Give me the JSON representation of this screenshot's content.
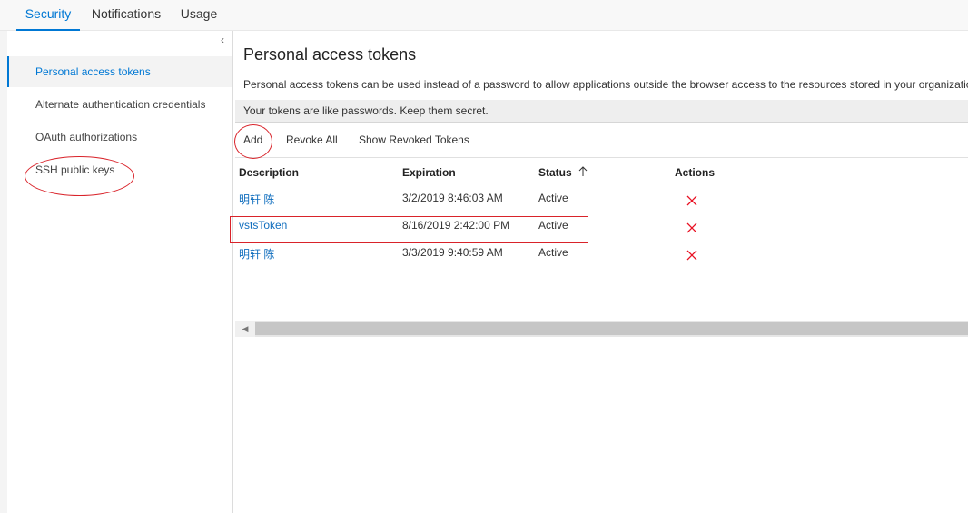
{
  "tabs": [
    {
      "label": "Security"
    },
    {
      "label": "Notifications"
    },
    {
      "label": "Usage"
    }
  ],
  "sidebar": {
    "collapse_glyph": "‹",
    "items": [
      {
        "label": "Personal access tokens"
      },
      {
        "label": "Alternate authentication credentials"
      },
      {
        "label": "OAuth authorizations"
      },
      {
        "label": "SSH public keys"
      }
    ]
  },
  "main": {
    "title": "Personal access tokens",
    "description": "Personal access tokens can be used instead of a password to allow applications outside the browser access to the resources stored in your organization",
    "banner": "Your tokens are like passwords. Keep them secret.",
    "toolbar": {
      "add_label": "Add",
      "revoke_all_label": "Revoke All",
      "show_revoked_label": "Show Revoked Tokens"
    },
    "table": {
      "headers": {
        "description": "Description",
        "expiration": "Expiration",
        "status": "Status",
        "actions": "Actions"
      },
      "sort_icon": "sort-arrow-up-icon",
      "rows": [
        {
          "description": "明轩 陈",
          "expiration": "3/2/2019 8:46:03 AM",
          "status": "Active",
          "action_icon": "revoke-x-icon"
        },
        {
          "description": "vstsToken",
          "expiration": "8/16/2019 2:42:00 PM",
          "status": "Active",
          "action_icon": "revoke-x-icon"
        },
        {
          "description": "明轩 陈",
          "expiration": "3/3/2019 9:40:59 AM",
          "status": "Active",
          "action_icon": "revoke-x-icon"
        }
      ]
    }
  },
  "colors": {
    "accent": "#0078d4",
    "link": "#106ebe",
    "delete": "#e81123",
    "annotation": "#d9232a"
  }
}
